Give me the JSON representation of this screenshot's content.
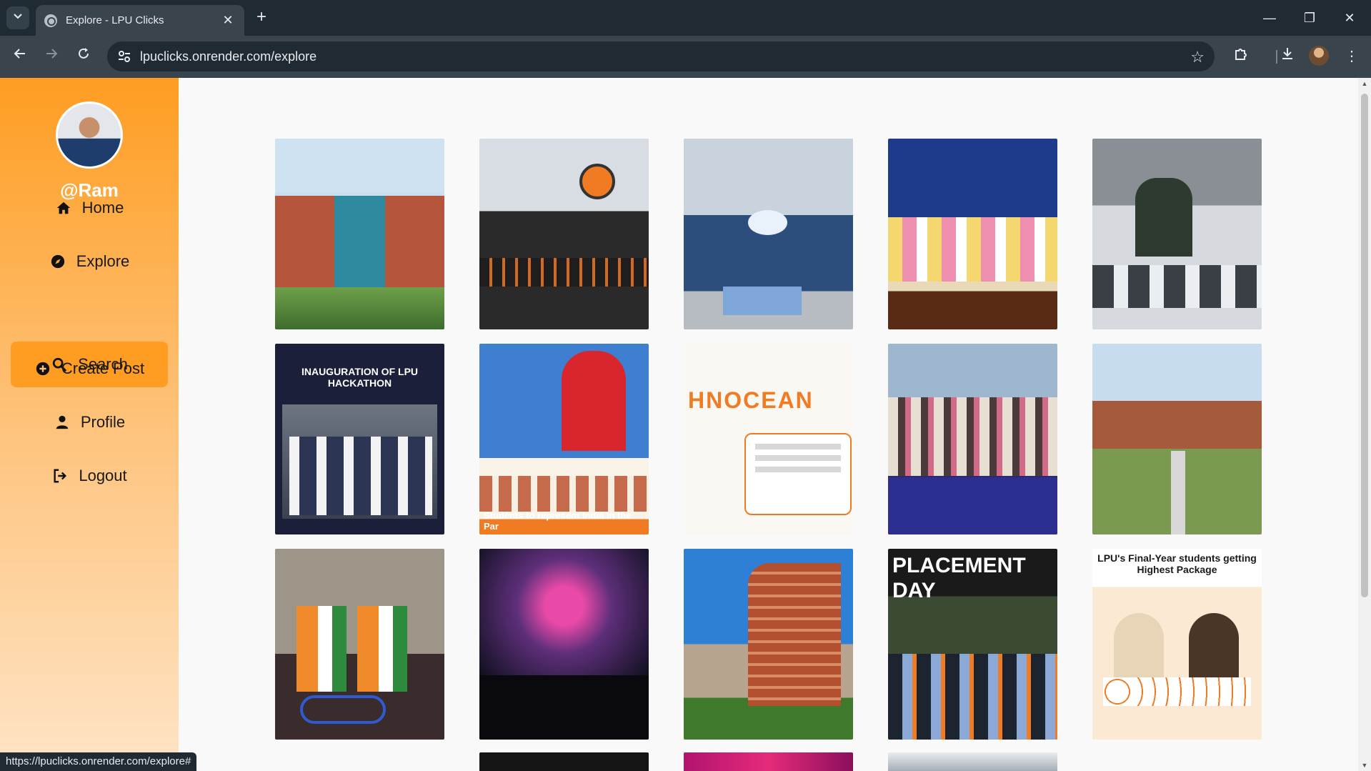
{
  "browser": {
    "tab_title": "Explore - LPU Clicks",
    "url": "lpuclicks.onrender.com/explore",
    "status_url": "https://lpuclicks.onrender.com/explore#"
  },
  "sidebar": {
    "username": "@Ram",
    "items": [
      {
        "label": "Home",
        "icon": "home-icon"
      },
      {
        "label": "Explore",
        "icon": "compass-icon"
      },
      {
        "label": "Search",
        "icon": "search-icon",
        "active": true
      },
      {
        "label": "Create Post",
        "icon": "plus-circle-icon"
      },
      {
        "label": "Profile",
        "icon": "user-icon"
      },
      {
        "label": "Logout",
        "icon": "logout-icon"
      }
    ]
  },
  "posts": [
    {
      "caption": ""
    },
    {
      "caption": ""
    },
    {
      "caption": ""
    },
    {
      "caption": ""
    },
    {
      "caption": ""
    },
    {
      "caption": "INAUGURATION OF LPU HACKATHON"
    },
    {
      "caption": "Students to represent India in the Par"
    },
    {
      "caption": "HNOCEAN"
    },
    {
      "caption": ""
    },
    {
      "caption": ""
    },
    {
      "caption": ""
    },
    {
      "caption": ""
    },
    {
      "caption": ""
    },
    {
      "caption": "PLACEMENT DAY"
    },
    {
      "caption": "LPU's Final-Year students getting Highest Package"
    }
  ],
  "colors": {
    "sidebar_accent": "#fe9d22",
    "chrome_dark": "#1f2a32",
    "chrome_mid": "#3a444c"
  }
}
